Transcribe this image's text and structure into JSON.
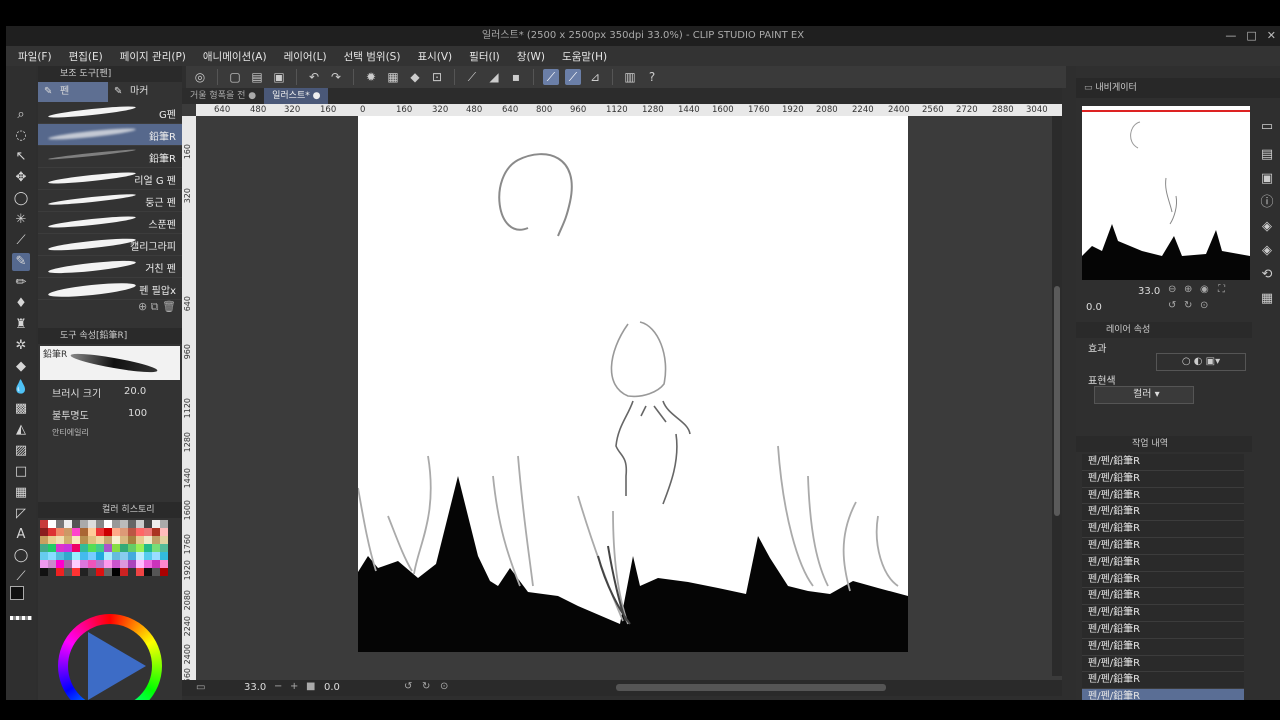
{
  "window": {
    "title": "일러스트* (2500 x 2500px 350dpi 33.0%)  - CLIP STUDIO PAINT EX",
    "controls": [
      "—",
      "□",
      "✕"
    ]
  },
  "menu": [
    "파일(F)",
    "편집(E)",
    "페이지 관리(P)",
    "애니메이션(A)",
    "레이어(L)",
    "선택 범위(S)",
    "표시(V)",
    "필터(I)",
    "창(W)",
    "도움말(H)"
  ],
  "subtool": {
    "header": "보조 도구[펜]",
    "tabs": [
      "펜",
      "마커"
    ],
    "brushes": [
      "G펜",
      "鉛筆R",
      "鉛筆R",
      "리얼 G 펜",
      "둥근 펜",
      "스푼펜",
      "캘리그라피",
      "거친 펜",
      "펜 필압x"
    ],
    "selected_brush_index": 1
  },
  "tool_property": {
    "header": "도구 속성[鉛筆R]",
    "preview_label": "鉛筆R",
    "brush_size_label": "브러시 크기",
    "brush_size_value": "20.0",
    "opacity_label": "불투명도",
    "opacity_value": "100",
    "anti_alias_label": "안티에일리"
  },
  "color_history": {
    "header": "컬러 히스토리"
  },
  "canvas": {
    "tabs": [
      "거울 형폭을 전",
      "일러스트*"
    ],
    "ruler_h": [
      "640",
      "480",
      "320",
      "160",
      "0",
      "160",
      "320",
      "480",
      "640",
      "800",
      "960",
      "1120",
      "1280",
      "1440",
      "1600",
      "1760",
      "1920",
      "2080",
      "2240",
      "2400",
      "2560",
      "2720",
      "2880",
      "3040"
    ],
    "ruler_v": [
      "160",
      "320",
      "640",
      "960",
      "1120",
      "1280",
      "1440",
      "1600",
      "1760",
      "1920",
      "2080",
      "2240",
      "2400",
      "2560"
    ],
    "zoom": "33.0",
    "angle": "0.0"
  },
  "navigator": {
    "header": "내비게이터",
    "zoom": "33.0",
    "angle": "0.0"
  },
  "layer_property": {
    "header": "레이어 속성",
    "effect_label": "효과",
    "expression_label": "표현색",
    "expression_value": "컬러"
  },
  "history": {
    "header": "작업 내역",
    "items": [
      "펜/펜/鉛筆R",
      "펜/펜/鉛筆R",
      "펜/펜/鉛筆R",
      "펜/펜/鉛筆R",
      "펜/펜/鉛筆R",
      "펜/펜/鉛筆R",
      "펜/펜/鉛筆R",
      "펜/펜/鉛筆R",
      "펜/펜/鉛筆R",
      "펜/펜/鉛筆R",
      "펜/펜/鉛筆R",
      "펜/펜/鉛筆R",
      "펜/펜/鉛筆R",
      "펜/펜/鉛筆R",
      "펜/펜/鉛筆R"
    ],
    "selected_index": 14
  },
  "colors": {
    "accent": "#5e6f92",
    "canvas_bg": "#3b3b3b",
    "panel_bg": "#333333"
  }
}
